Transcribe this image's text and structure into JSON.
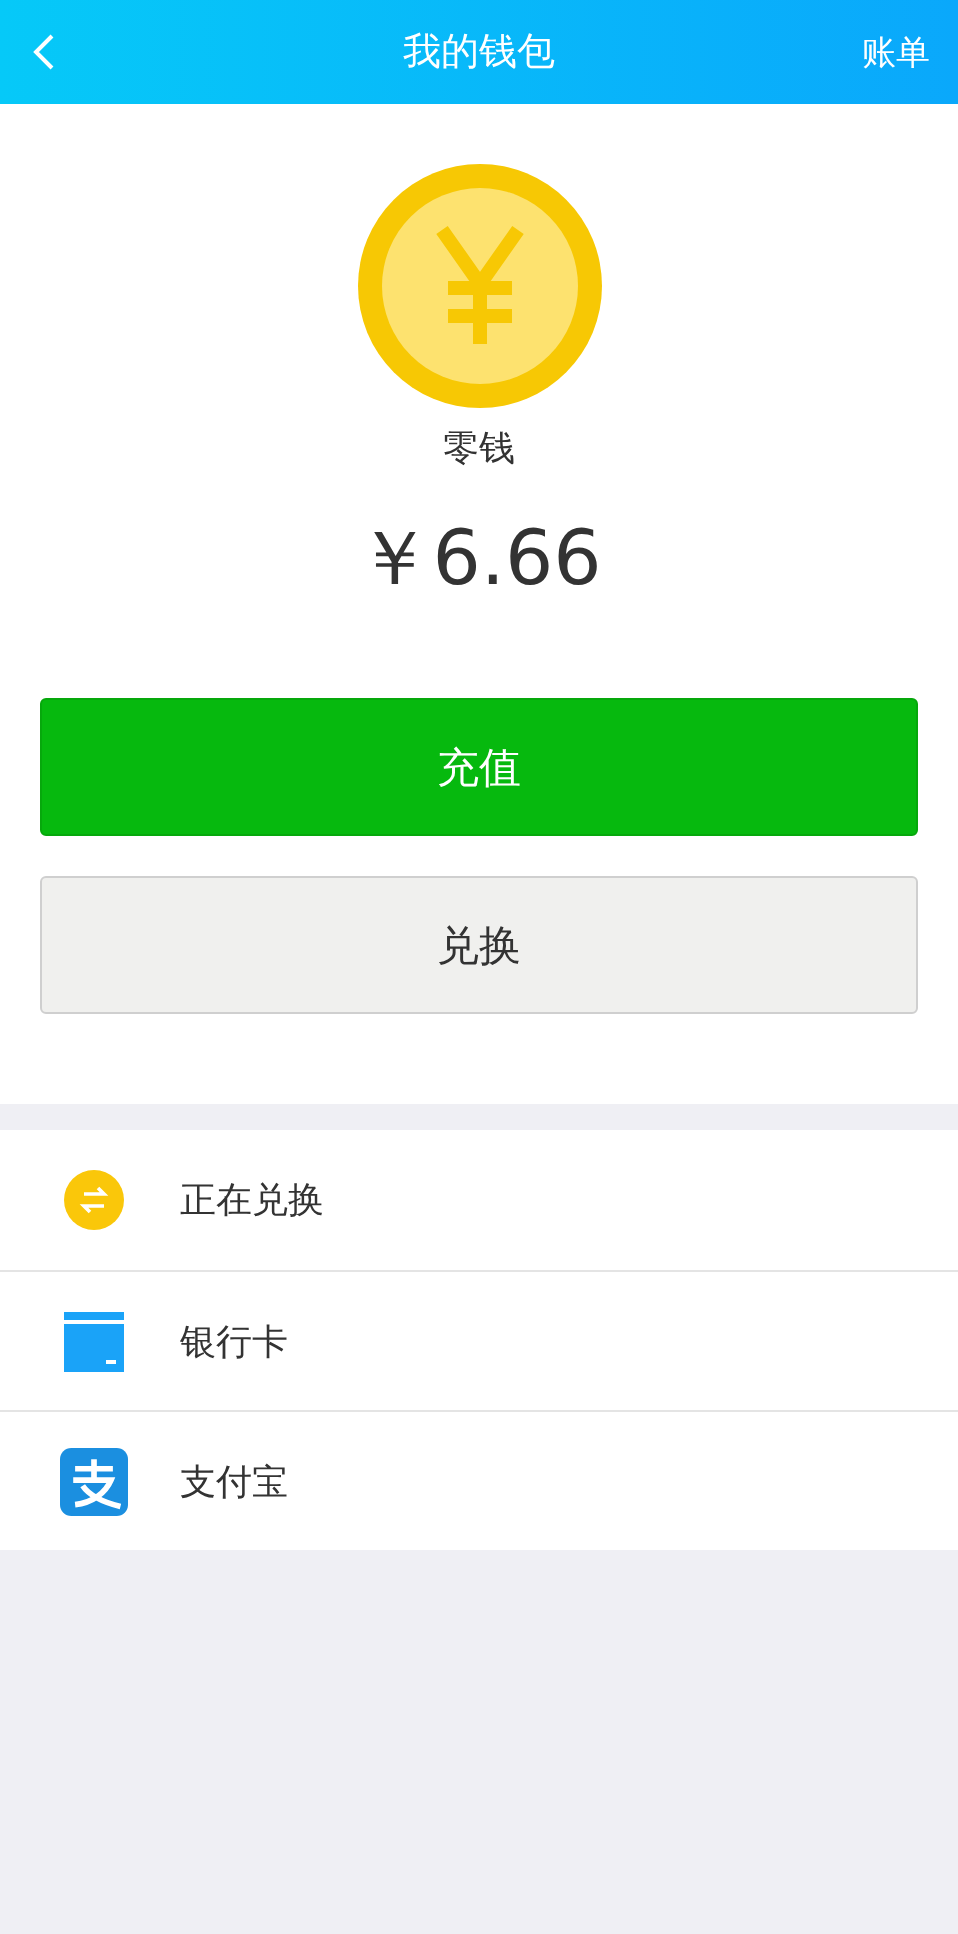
{
  "header": {
    "title": "我的钱包",
    "action": "账单"
  },
  "balance": {
    "label": "零钱",
    "amount": "￥6.66"
  },
  "buttons": [
    {
      "label": "充值",
      "kind": "primary"
    },
    {
      "label": "兑换",
      "kind": "secondary"
    }
  ],
  "menu": [
    {
      "label": "正在兑换",
      "kind": "exchange"
    },
    {
      "label": "银行卡",
      "kind": "card"
    },
    {
      "label": "支付宝",
      "kind": "alipay"
    }
  ]
}
